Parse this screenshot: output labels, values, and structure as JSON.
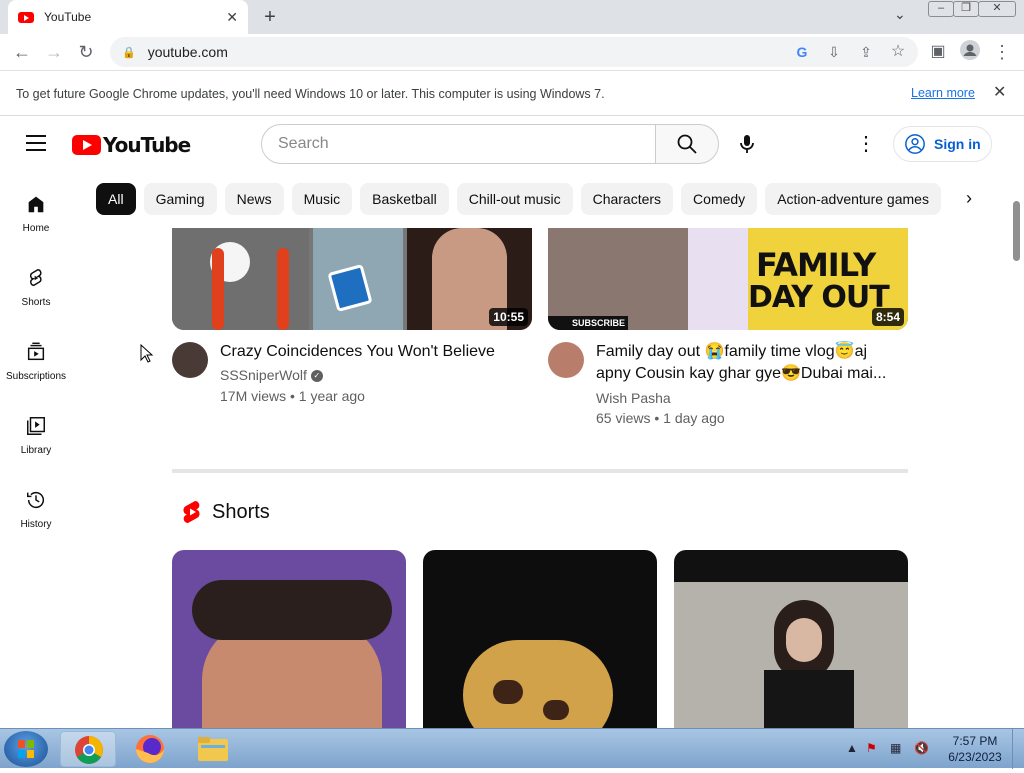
{
  "browser": {
    "tab_title": "YouTube",
    "tab_close": "✕",
    "new_tab": "+",
    "url": "youtube.com",
    "tab_menu": "⌄"
  },
  "infobar": {
    "message": "To get future Google Chrome updates, you'll need Windows 10 or later. This computer is using Windows 7.",
    "link": "Learn more",
    "close": "✕"
  },
  "youtube": {
    "logo_text": "YouTube",
    "search_placeholder": "Search",
    "sign_in": "Sign in",
    "chips": [
      "All",
      "Gaming",
      "News",
      "Music",
      "Basketball",
      "Chill-out music",
      "Characters",
      "Comedy",
      "Action-adventure games"
    ],
    "sidebar": [
      {
        "label": "Home",
        "icon": "home-icon"
      },
      {
        "label": "Shorts",
        "icon": "shorts-icon"
      },
      {
        "label": "Subscriptions",
        "icon": "subscriptions-icon"
      },
      {
        "label": "Library",
        "icon": "library-icon"
      },
      {
        "label": "History",
        "icon": "history-icon"
      }
    ],
    "videos": [
      {
        "title": "Crazy Coincidences You Won't Believe",
        "channel": "SSSniperWolf",
        "verified": true,
        "stats": "17M views • 1 year ago",
        "duration": "10:55"
      },
      {
        "title_line1": "Family day out 😭family time vlog😇aj",
        "title_line2": "apny Cousin kay ghar gye😎Dubai mai...",
        "channel": "Wish Pasha",
        "stats": "65 views • 1 day ago",
        "duration": "8:54",
        "thumb_text_1": "FAMILY",
        "thumb_text_2": "DAY OUT",
        "subscribe": "SUBSCRIBE"
      }
    ],
    "shorts_heading": "Shorts"
  },
  "taskbar": {
    "time": "7:57 PM",
    "date": "6/23/2023"
  }
}
